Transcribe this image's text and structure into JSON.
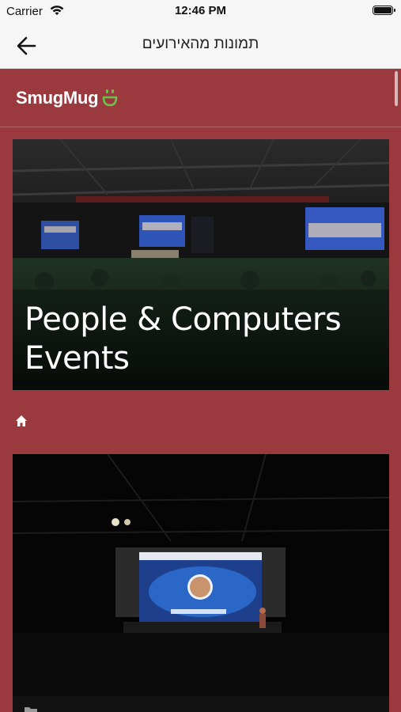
{
  "status_bar": {
    "carrier": "Carrier",
    "time": "12:46 PM"
  },
  "nav": {
    "title": "תמונות מהאירועים"
  },
  "brand": {
    "name": "SmugMug",
    "accent_color": "#6cc04a"
  },
  "hero": {
    "title_line1": "People & Computers",
    "title_line2": "Events"
  },
  "icons": {
    "back": "arrow-left-icon",
    "home": "home-icon",
    "folder": "folder-icon",
    "wifi": "wifi-icon",
    "battery": "battery-icon"
  },
  "colors": {
    "background": "#9a3a3e",
    "nav_bar": "#f6f6f6"
  }
}
